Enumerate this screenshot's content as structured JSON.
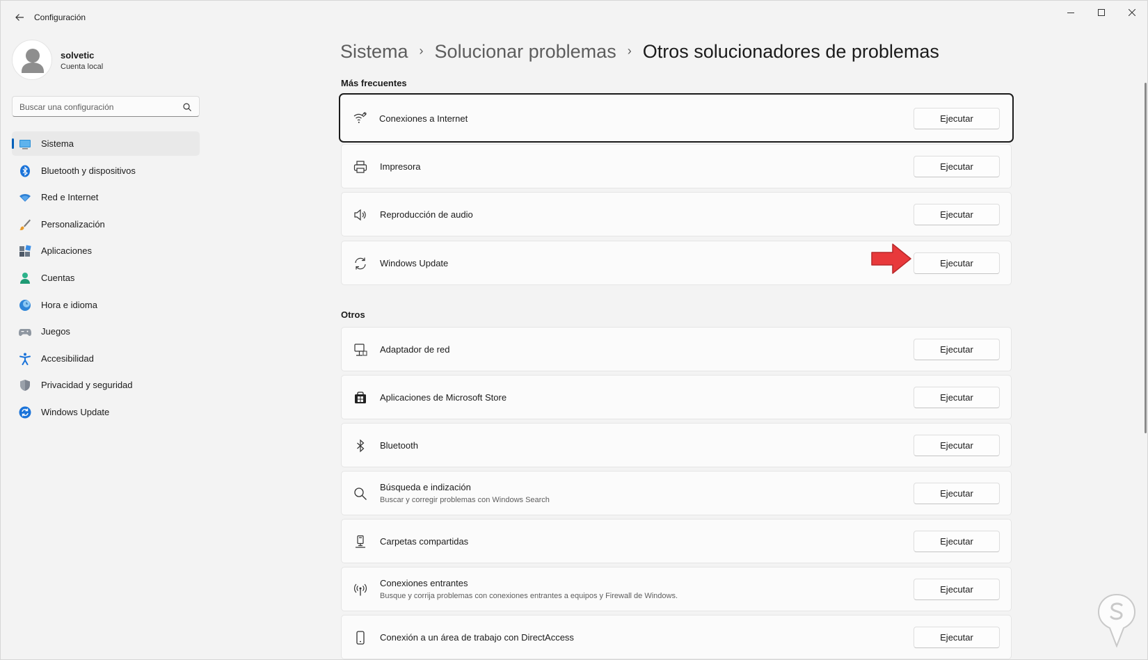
{
  "app": {
    "title": "Configuración"
  },
  "profile": {
    "name": "solvetic",
    "account_type": "Cuenta local"
  },
  "search": {
    "placeholder": "Buscar una configuración"
  },
  "sidebar": {
    "items": [
      {
        "label": "Sistema",
        "icon": "monitor-icon",
        "active": true
      },
      {
        "label": "Bluetooth y dispositivos",
        "icon": "bluetooth-icon"
      },
      {
        "label": "Red e Internet",
        "icon": "wifi-icon"
      },
      {
        "label": "Personalización",
        "icon": "brush-icon"
      },
      {
        "label": "Aplicaciones",
        "icon": "apps-icon"
      },
      {
        "label": "Cuentas",
        "icon": "person-icon"
      },
      {
        "label": "Hora e idioma",
        "icon": "clock-globe-icon"
      },
      {
        "label": "Juegos",
        "icon": "gamepad-icon"
      },
      {
        "label": "Accesibilidad",
        "icon": "accessibility-icon"
      },
      {
        "label": "Privacidad y seguridad",
        "icon": "shield-icon"
      },
      {
        "label": "Windows Update",
        "icon": "windows-update-icon"
      }
    ]
  },
  "breadcrumb": {
    "items": [
      "Sistema",
      "Solucionar problemas"
    ],
    "current": "Otros solucionadores de problemas",
    "separator": "›"
  },
  "sections": {
    "frequent": {
      "title": "Más frecuentes",
      "items": [
        {
          "label": "Conexiones a Internet",
          "icon": "wifi-wrench-icon",
          "button": "Ejecutar"
        },
        {
          "label": "Impresora",
          "icon": "printer-icon",
          "button": "Ejecutar"
        },
        {
          "label": "Reproducción de audio",
          "icon": "speaker-icon",
          "button": "Ejecutar"
        },
        {
          "label": "Windows Update",
          "icon": "sync-icon",
          "button": "Ejecutar"
        }
      ]
    },
    "others": {
      "title": "Otros",
      "items": [
        {
          "label": "Adaptador de red",
          "icon": "network-monitor-icon",
          "button": "Ejecutar"
        },
        {
          "label": "Aplicaciones de Microsoft Store",
          "icon": "store-icon",
          "button": "Ejecutar"
        },
        {
          "label": "Bluetooth",
          "icon": "bluetooth-icon",
          "button": "Ejecutar"
        },
        {
          "label": "Búsqueda e indización",
          "description": "Buscar y corregir problemas con Windows Search",
          "icon": "search-icon",
          "button": "Ejecutar"
        },
        {
          "label": "Carpetas compartidas",
          "icon": "shared-folder-icon",
          "button": "Ejecutar"
        },
        {
          "label": "Conexiones entrantes",
          "description": "Busque y corrija problemas con conexiones entrantes a equipos y Firewall de Windows.",
          "icon": "antenna-icon",
          "button": "Ejecutar"
        },
        {
          "label": "Conexión a un área de trabajo con DirectAccess",
          "icon": "phone-device-icon",
          "button": "Ejecutar"
        }
      ]
    }
  },
  "colors": {
    "accent": "#005fb8",
    "annotation_arrow": "#e8393b",
    "focus_border": "#1a1a1a"
  }
}
